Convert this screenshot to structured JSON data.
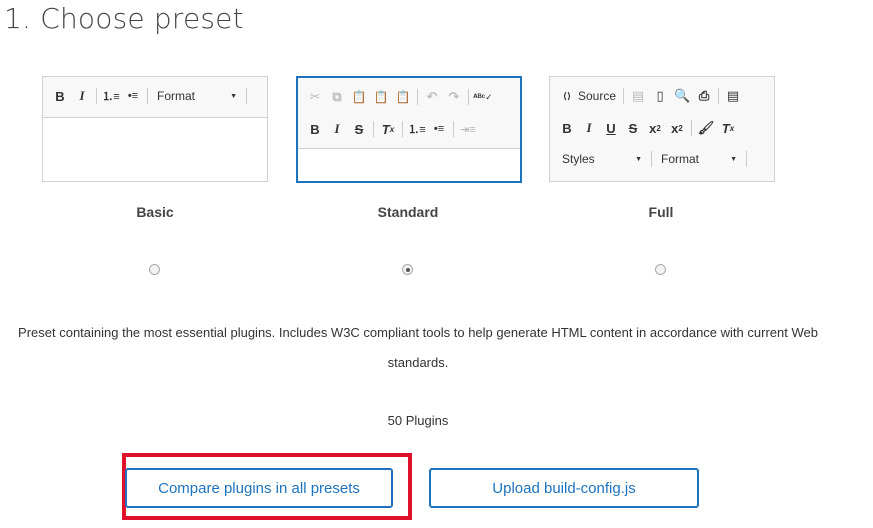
{
  "header": {
    "title": "1. Choose preset"
  },
  "presets": [
    {
      "name": "Basic",
      "selected": false,
      "toolbar": {
        "buttons": [
          "B",
          "I",
          "numbered-list",
          "bulleted-list"
        ],
        "format_label": "Format"
      }
    },
    {
      "name": "Standard",
      "selected": true,
      "toolbar": {
        "row1": [
          "cut",
          "copy",
          "paste",
          "paste-text",
          "paste-word",
          "undo",
          "redo",
          "spellcheck"
        ],
        "row2": [
          "B",
          "I",
          "S",
          "Tx",
          "numbered-list",
          "bulleted-list",
          "blockquote"
        ]
      }
    },
    {
      "name": "Full",
      "selected": false,
      "toolbar": {
        "source_label": "Source",
        "row1": [
          "source",
          "save",
          "new-page",
          "preview",
          "print",
          "templates"
        ],
        "row2": [
          "B",
          "I",
          "U",
          "S",
          "x2-sub",
          "x2-sup",
          "copy-format",
          "Tx"
        ],
        "styles_label": "Styles",
        "format_label": "Format"
      }
    }
  ],
  "description": "Preset containing the most essential plugins. Includes W3C compliant tools to help generate HTML content in accordance with current Web standards.",
  "plugins_count": "50 Plugins",
  "actions": {
    "compare_label": "Compare plugins in all presets",
    "upload_label": "Upload build-config.js"
  },
  "colors": {
    "accent": "#1e73be",
    "highlight": "#e0102a"
  }
}
